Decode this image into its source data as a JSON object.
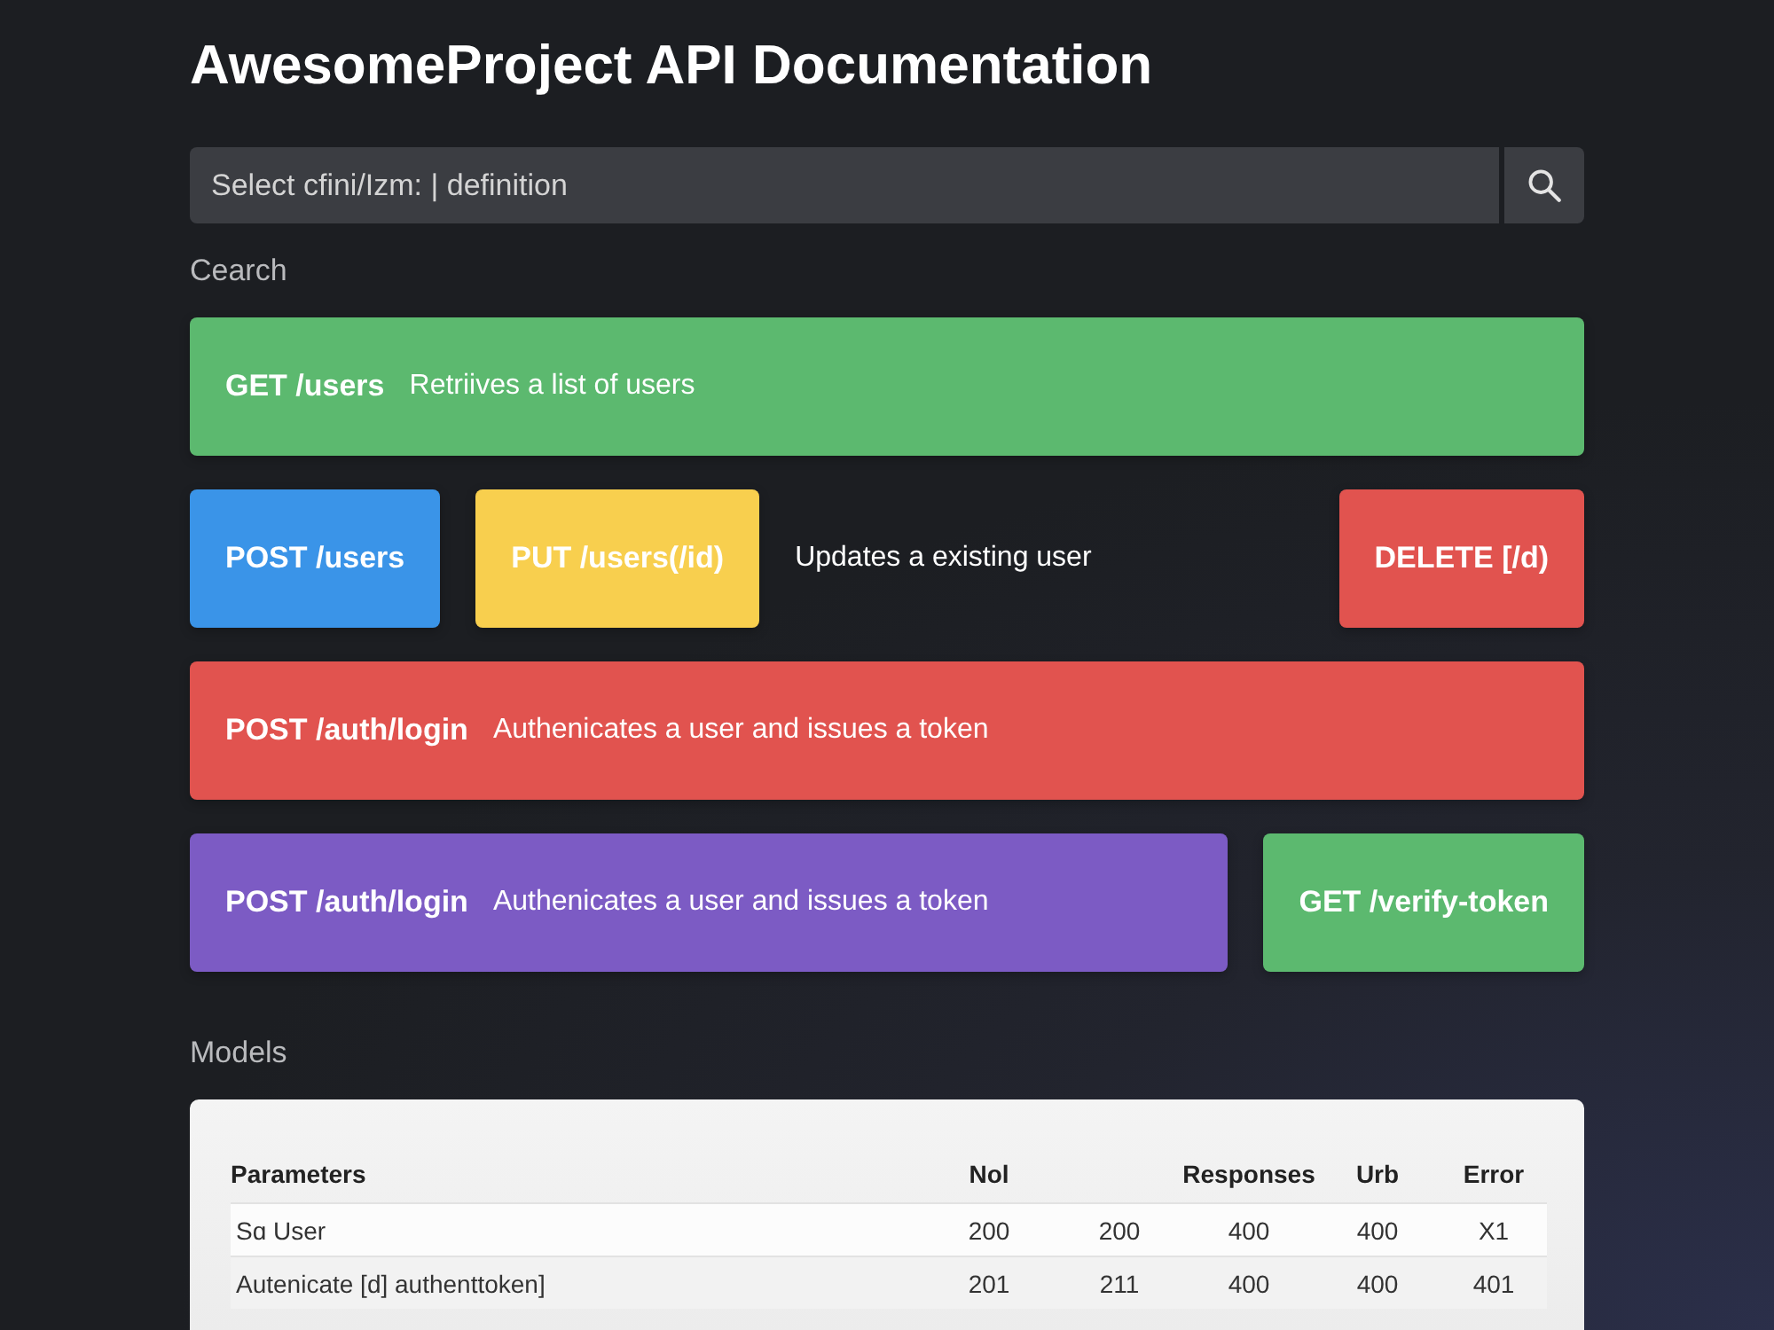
{
  "page": {
    "title": "AwesomeProject API Documentation"
  },
  "search": {
    "placeholder": "Select cfini/Izm: | definition"
  },
  "search_label": "Cearch",
  "endpoint_rows": [
    {
      "items": [
        {
          "kind": "card",
          "endpoint": "GET /users",
          "description": "Retriives a list of users",
          "color": "#5cb96f"
        }
      ]
    },
    {
      "items": [
        {
          "kind": "card",
          "endpoint": "POST /users",
          "color": "#3a94e8"
        },
        {
          "kind": "card",
          "endpoint": "PUT /users(/id)",
          "color": "#f8cf4e"
        },
        {
          "kind": "note",
          "description": "Updates a existing user"
        },
        {
          "kind": "card",
          "endpoint": "DELETE [/d)",
          "color": "#e1534f"
        }
      ]
    },
    {
      "items": [
        {
          "kind": "card",
          "endpoint": "POST /auth/login",
          "description": "Authenicates a user and issues a token",
          "color": "#e1534f"
        }
      ]
    },
    {
      "items": [
        {
          "kind": "card",
          "endpoint": "POST /auth/login",
          "description": "Authenicates a user and issues a token",
          "color": "#7c5bc4"
        },
        {
          "kind": "card",
          "endpoint": "GET /verify-token",
          "color": "#5cb96f"
        }
      ]
    }
  ],
  "models": {
    "heading": "Models",
    "table": {
      "columns": [
        {
          "label": "Parameters"
        },
        {
          "label": "Nol"
        },
        {},
        {
          "label": "Responses"
        },
        {
          "label": "Urb"
        },
        {
          "label": "Error"
        }
      ],
      "rows": [
        [
          "Sɑ User",
          "200",
          "200",
          "400",
          "400",
          "X1"
        ],
        [
          "Autenicate [d] authenttoken]",
          "201",
          "211",
          "400",
          "400",
          "401"
        ]
      ]
    }
  }
}
